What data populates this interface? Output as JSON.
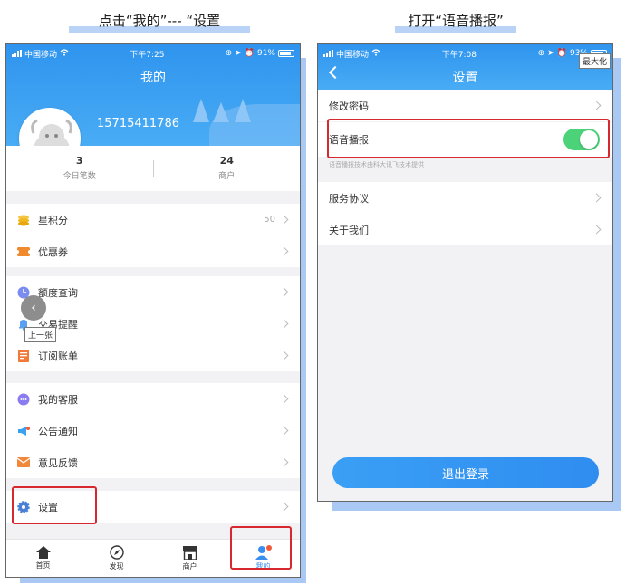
{
  "captions": {
    "left": "点击“我的”--- “设置",
    "right": "打开“语音播报”"
  },
  "phone1": {
    "status": {
      "carrier": "中国移动",
      "time": "下午7:25",
      "battery": "91%"
    },
    "title": "我的",
    "phone_number": "15715411786",
    "stats": [
      {
        "value": "3",
        "label": "今日笔数"
      },
      {
        "value": "24",
        "label": "商户"
      }
    ],
    "groups": [
      [
        {
          "label": "星积分",
          "value": "50",
          "icon": "coins-icon"
        },
        {
          "label": "优惠券",
          "icon": "ticket-icon"
        }
      ],
      [
        {
          "label": "额度查询",
          "icon": "clock-icon"
        },
        {
          "label": "交易提醒",
          "icon": "bell-icon"
        },
        {
          "label": "订阅账单",
          "icon": "bill-icon"
        }
      ],
      [
        {
          "label": "我的客服",
          "icon": "chat-icon"
        },
        {
          "label": "公告通知",
          "icon": "megaphone-icon"
        },
        {
          "label": "意见反馈",
          "icon": "mail-icon"
        }
      ],
      [
        {
          "label": "设置",
          "icon": "gear-icon"
        }
      ]
    ],
    "tabs": [
      {
        "label": "首页",
        "icon": "home-icon"
      },
      {
        "label": "发现",
        "icon": "compass-icon"
      },
      {
        "label": "商户",
        "icon": "store-icon"
      },
      {
        "label": "我的",
        "icon": "profile-icon"
      }
    ],
    "overlay": {
      "prev_tooltip": "上一张"
    },
    "colors": {
      "header": "#3a9ff5",
      "highlight": "#d7272f",
      "tab_active": "#3a8ef0"
    }
  },
  "phone2": {
    "status": {
      "carrier": "中国移动",
      "time": "下午7:08",
      "battery": "93%"
    },
    "title": "设置",
    "maximize_tooltip": "最大化",
    "rows": [
      {
        "label": "修改密码"
      },
      {
        "label": "语音播报",
        "toggle": true
      },
      {
        "label": "服务协议"
      },
      {
        "label": "关于我们"
      }
    ],
    "voice_hint": "语音播报技术由科大讯飞技术提供",
    "logout_label": "退出登录",
    "colors": {
      "toggle_on": "#4cd37a"
    }
  }
}
